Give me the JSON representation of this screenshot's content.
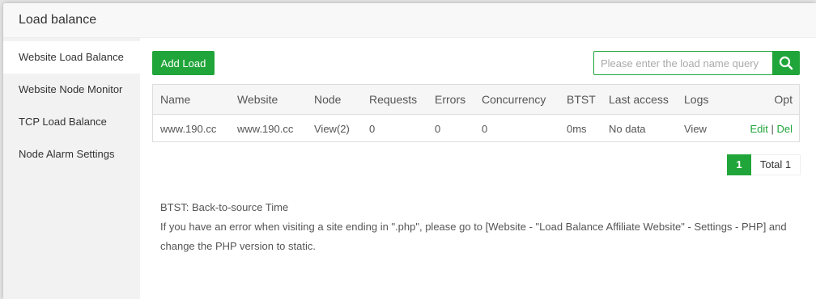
{
  "dialog": {
    "title": "Load balance"
  },
  "sidebar": {
    "items": [
      {
        "label": "Website Load Balance",
        "active": true
      },
      {
        "label": "Website Node Monitor",
        "active": false
      },
      {
        "label": "TCP Load Balance",
        "active": false
      },
      {
        "label": "Node Alarm Settings",
        "active": false
      }
    ]
  },
  "toolbar": {
    "add_label": "Add Load",
    "search_placeholder": "Please enter the load name query",
    "search_icon": "search-icon"
  },
  "table": {
    "headers": {
      "name": "Name",
      "website": "Website",
      "node": "Node",
      "requests": "Requests",
      "errors": "Errors",
      "concurrency": "Concurrency",
      "btst": "BTST",
      "last_access": "Last access",
      "logs": "Logs",
      "opt": "Opt"
    },
    "rows": [
      {
        "name": "www.190.cc",
        "website": "www.190.cc",
        "node": "View(2)",
        "requests": "0",
        "errors": "0",
        "concurrency": "0",
        "btst": "0ms",
        "last_access": "No data",
        "logs": "View",
        "edit": "Edit",
        "sep": "|",
        "del": "Del"
      }
    ]
  },
  "pagination": {
    "current": "1",
    "total": "Total 1"
  },
  "notes": {
    "line1": "BTST: Back-to-source Time",
    "line2": "If you have an error when visiting a site ending in \".php\", please go to [Website - \"Load Balance Affiliate Website\" - Settings - PHP] and",
    "line3": "change the PHP version to static."
  },
  "colors": {
    "accent": "#20a53a",
    "sidebar_bg": "#f2f2f2",
    "header_bg": "#f6f6f6"
  }
}
